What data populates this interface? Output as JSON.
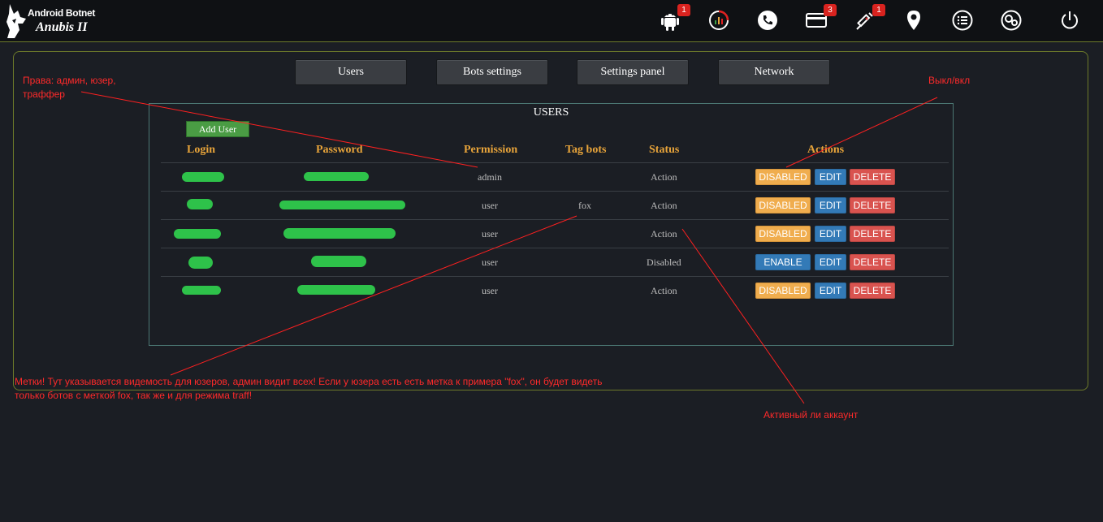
{
  "header": {
    "logo_line1": "Android Botnet",
    "logo_line2": "Anubis II",
    "icons": [
      {
        "name": "android-icon",
        "badge": "1"
      },
      {
        "name": "stats-icon",
        "badge": ""
      },
      {
        "name": "phone-icon",
        "badge": ""
      },
      {
        "name": "card-icon",
        "badge": "3"
      },
      {
        "name": "injection-icon",
        "badge": "1"
      },
      {
        "name": "location-icon",
        "badge": ""
      },
      {
        "name": "list-icon",
        "badge": ""
      },
      {
        "name": "settings-icon",
        "badge": ""
      },
      {
        "name": "power-icon",
        "badge": ""
      }
    ]
  },
  "tabs": [
    "Users",
    "Bots settings",
    "Settings panel",
    "Network"
  ],
  "users": {
    "title": "USERS",
    "add_user": "Add User",
    "columns": [
      "Login",
      "Password",
      "Permission",
      "Tag bots",
      "Status",
      "Actions"
    ],
    "rows": [
      {
        "permission": "admin",
        "tag": "",
        "status": "Action",
        "toggle": "DISABLED"
      },
      {
        "permission": "user",
        "tag": "fox",
        "status": "Action",
        "toggle": "DISABLED"
      },
      {
        "permission": "user",
        "tag": "",
        "status": "Action",
        "toggle": "DISABLED"
      },
      {
        "permission": "user",
        "tag": "",
        "status": "Disabled",
        "toggle": "ENABLE"
      },
      {
        "permission": "user",
        "tag": "",
        "status": "Action",
        "toggle": "DISABLED"
      }
    ],
    "edit_label": "EDIT",
    "delete_label": "DELETE"
  },
  "annotations": {
    "rights": "Права: админ, юзер, траффер",
    "onoff": "Выкл/вкл",
    "tags": "Метки! Тут указывается видемость для юзеров, админ видит всех! Если у юзера есть есть метка к примера \"fox\", он будет видеть только ботов с меткой fox, так же и для режима traff!",
    "active": "Активный ли аккаунт"
  },
  "colors": {
    "accent_orange": "#e8a43a",
    "annotation_red": "#ff2a2a",
    "redaction_green": "#2ec24a"
  }
}
